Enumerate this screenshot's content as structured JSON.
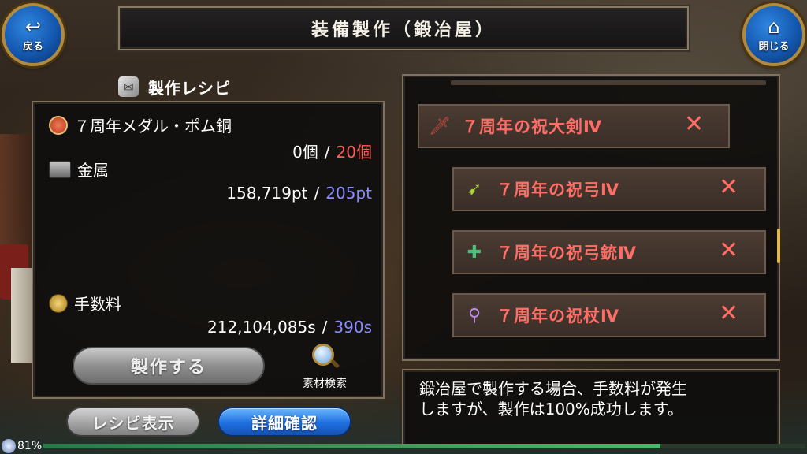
{
  "header": {
    "title": "装備製作（鍛冶屋）",
    "back_label": "戻る",
    "close_label": "閉じる"
  },
  "recipe": {
    "heading": "製作レシピ",
    "materials": [
      {
        "name": "７周年メダル・ポム銅",
        "owned": "0個",
        "separator": "/",
        "required": "20個",
        "required_color": "#ff5a55",
        "icon": "medal-icon"
      },
      {
        "name": "金属",
        "owned": "158,719pt",
        "separator": "/",
        "required": "205pt",
        "required_color": "#8a8cff",
        "icon": "metal-ingot-icon"
      }
    ],
    "fee": {
      "name": "手数料",
      "owned": "212,104,085s",
      "separator": "/",
      "required": "390s",
      "required_color": "#8a8cff",
      "icon": "coins-icon"
    },
    "craft_button": "製作する",
    "search_label": "素材検索"
  },
  "bottom_buttons": {
    "recipe_display": "レシピ表示",
    "detail_confirm": "詳細確認"
  },
  "result_items": [
    {
      "name": "７周年の祝大剣Ⅳ",
      "icon": "greatsword-icon",
      "status": "✕"
    },
    {
      "name": "７周年の祝弓Ⅳ",
      "icon": "bow-icon",
      "status": "✕"
    },
    {
      "name": "７周年の祝弓銃Ⅳ",
      "icon": "crossbow-icon",
      "status": "✕"
    },
    {
      "name": "７周年の祝杖Ⅳ",
      "icon": "staff-icon",
      "status": "✕"
    }
  ],
  "message": {
    "line1": "鍛冶屋で製作する場合、手数料が発生",
    "line2": "しますが、製作は100%成功します。"
  },
  "status_bar": {
    "percent_label": "81%",
    "progress": 0.81
  }
}
